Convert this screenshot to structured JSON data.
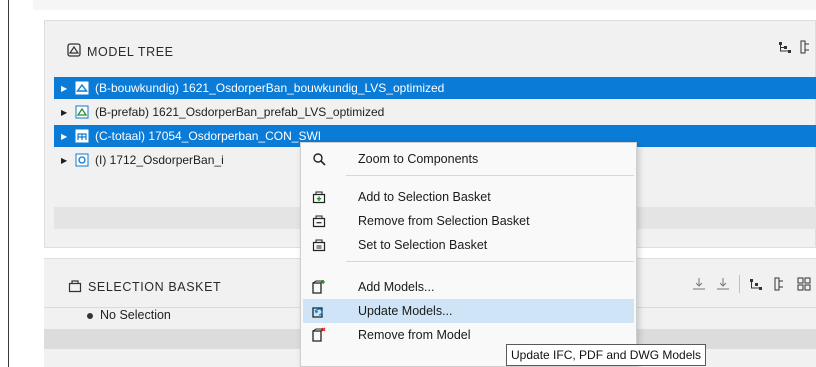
{
  "model_tree": {
    "title": "MODEL TREE",
    "rows": [
      {
        "label": "(B-bouwkundig) 1621_OsdorperBan_bouwkundig_LVS_optimized",
        "selected": true
      },
      {
        "label": "(B-prefab) 1621_OsdorperBan_prefab_LVS_optimized",
        "selected": false
      },
      {
        "label": "(C-totaal) 17054_Osdorperban_CON_SWI",
        "selected": true
      },
      {
        "label": "(I) 1712_OsdorperBan_i",
        "selected": false
      }
    ]
  },
  "selection_basket": {
    "title": "SELECTION BASKET",
    "empty_text": "No Selection"
  },
  "context_menu": {
    "items": [
      {
        "label": "Zoom to Components",
        "icon": "search-icon"
      },
      {
        "label": "Add to Selection Basket",
        "icon": "basket-add-icon"
      },
      {
        "label": "Remove from Selection Basket",
        "icon": "basket-remove-icon"
      },
      {
        "label": "Set to Selection Basket",
        "icon": "basket-set-icon"
      },
      {
        "label": "Add Models...",
        "icon": "add-model-icon"
      },
      {
        "label": "Update Models...",
        "icon": "update-model-icon",
        "hover": true
      },
      {
        "label": "Remove from Model",
        "icon": "remove-model-icon"
      }
    ]
  },
  "tooltip": {
    "text": "Update IFC, PDF and DWG Models"
  },
  "colors": {
    "selection": "#0a7bd6",
    "menu_hover": "#cfe5f7",
    "panel_bg": "#f1f1f1"
  }
}
